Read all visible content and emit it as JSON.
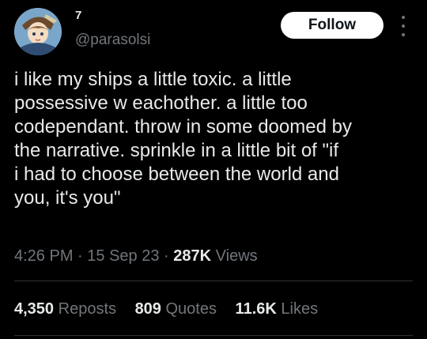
{
  "author": {
    "display_name": "7",
    "handle": "@parasolsi"
  },
  "follow_button": {
    "label": "Follow"
  },
  "tweet": {
    "text": "i like my ships a little toxic. a little\npossessive w eachother. a little too\ncodependant. throw in some doomed by\nthe narrative. sprinkle in a little bit of \"if\ni had to choose between the world and\nyou, it's you\"",
    "time": "4:26 PM",
    "sep1": "·",
    "date": "15 Sep 23",
    "sep2": "·",
    "views_count": "287K",
    "views_label": "Views"
  },
  "stats": {
    "reposts_count": "4,350",
    "reposts_label": "Reposts",
    "quotes_count": "809",
    "quotes_label": "Quotes",
    "likes_count": "11.6K",
    "likes_label": "Likes"
  },
  "colors": {
    "background": "#000000",
    "text": "#e7e9ea",
    "secondary": "#71767b",
    "divider": "#2f3336",
    "button_bg": "#ffffff"
  }
}
